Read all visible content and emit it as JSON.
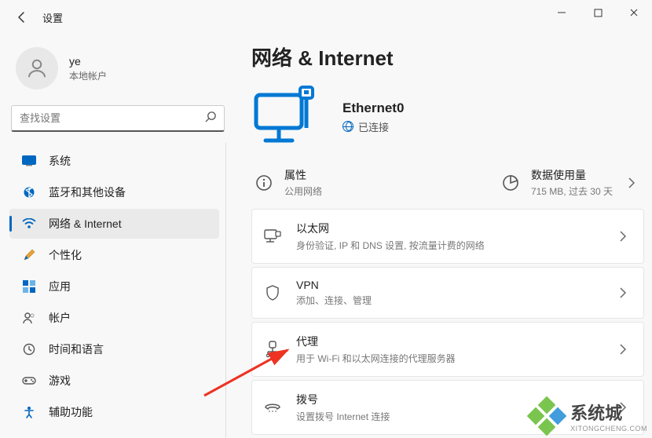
{
  "window": {
    "title": "设置"
  },
  "user": {
    "name": "ye",
    "sub": "本地帐户"
  },
  "search": {
    "placeholder": "查找设置"
  },
  "sidebar": {
    "items": [
      {
        "label": "系统"
      },
      {
        "label": "蓝牙和其他设备"
      },
      {
        "label": "网络 & Internet"
      },
      {
        "label": "个性化"
      },
      {
        "label": "应用"
      },
      {
        "label": "帐户"
      },
      {
        "label": "时间和语言"
      },
      {
        "label": "游戏"
      },
      {
        "label": "辅助功能"
      }
    ],
    "active_index": 2
  },
  "page": {
    "title": "网络 & Internet"
  },
  "connection": {
    "name": "Ethernet0",
    "status": "已连接"
  },
  "info": {
    "props_label": "属性",
    "props_sub": "公用网络",
    "data_label": "数据使用量",
    "data_sub": "715 MB, 过去 30 天"
  },
  "cards": [
    {
      "title": "以太网",
      "sub": "身份验证, IP 和 DNS 设置, 按流量计费的网络"
    },
    {
      "title": "VPN",
      "sub": "添加、连接、管理"
    },
    {
      "title": "代理",
      "sub": "用于 Wi-Fi 和以太网连接的代理服务器"
    },
    {
      "title": "拨号",
      "sub": "设置拨号 Internet 连接"
    }
  ],
  "watermark": {
    "big": "系统城",
    "small": "XITONGCHENG.COM"
  }
}
